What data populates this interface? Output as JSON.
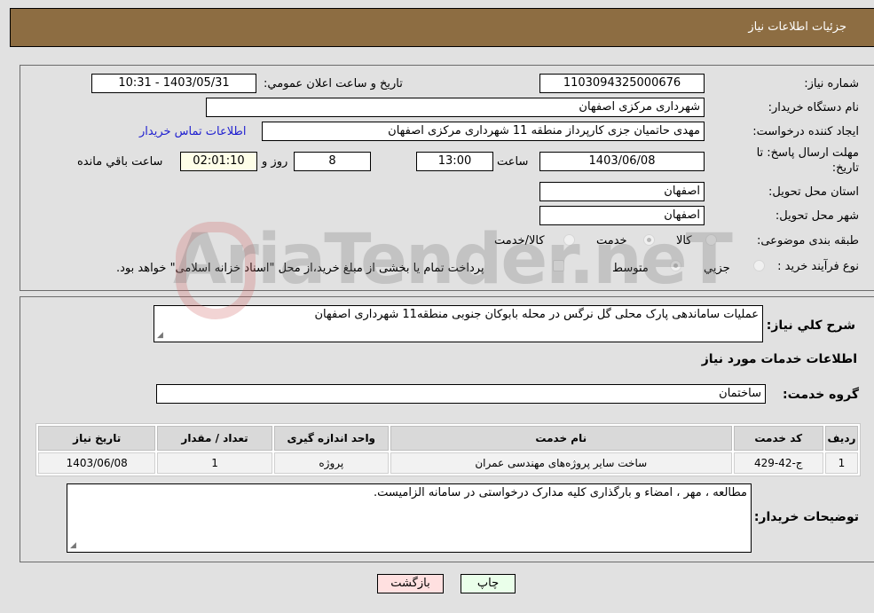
{
  "header": {
    "title": "جزئیات اطلاعات نیاز"
  },
  "form": {
    "need_number": {
      "label": "شماره نیاز:",
      "value": "1103094325000676"
    },
    "announce_datetime": {
      "label": "تاریخ و ساعت اعلان عمومي:",
      "value": "1403/05/31 - 10:31"
    },
    "buyer_org": {
      "label": "نام دستگاه خریدار:",
      "value": "شهرداری مرکزی اصفهان"
    },
    "requester": {
      "label": "ایجاد کننده درخواست:",
      "value": "مهدی حاتمیان جزی کارپرداز منطقه 11 شهرداری مرکزی اصفهان"
    },
    "buyer_contact_link": "اطلاعات تماس خریدار",
    "deadline": {
      "label_line1": "مهلت ارسال پاسخ: تا",
      "label_line2": "تاریخ:",
      "date": "1403/06/08",
      "time_label": "ساعت",
      "time": "13:00",
      "days": "8",
      "days_label": "روز و",
      "remaining": "02:01:10",
      "remaining_label": "ساعت باقي مانده"
    },
    "province": {
      "label": "استان محل تحویل:",
      "value": "اصفهان"
    },
    "city": {
      "label": "شهر محل تحویل:",
      "value": "اصفهان"
    },
    "category": {
      "label": "طبقه بندی موضوعی:",
      "options": [
        "کالا",
        "خدمت",
        "کالا/خدمت"
      ],
      "selected": "خدمت"
    },
    "process_type": {
      "label": "نوع فرآیند خرید :",
      "options": [
        "جزيي",
        "متوسط"
      ],
      "selected": "متوسط",
      "treasury_note": "پرداخت تمام یا بخشی از مبلغ خرید،از محل \"اسناد خزانه اسلامی\" خواهد بود."
    }
  },
  "details": {
    "general_desc_label": "شرح کلي نیاز:",
    "general_desc": "عملیات ساماندهی پارک محلی گل نرگس در محله بابوکان جنوبی منطقه11 شهرداری اصفهان",
    "services_heading": "اطلاعات خدمات مورد نیاز",
    "service_group_label": "گروه خدمت:",
    "service_group": "ساختمان",
    "table": {
      "headers": [
        "ردیف",
        "کد خدمت",
        "نام خدمت",
        "واحد اندازه گیری",
        "تعداد / مقدار",
        "تاریخ نیاز"
      ],
      "rows": [
        [
          "1",
          "ج-42-429",
          "ساخت سایر پروژه‌های مهندسی عمران",
          "پروژه",
          "1",
          "1403/06/08"
        ]
      ]
    },
    "buyer_notes_label": "توضیحات خریدار:",
    "buyer_notes": "مطالعه ، مهر ، امضاء و بارگذاری کلیه مدارک درخواستی در سامانه الزامیست."
  },
  "buttons": {
    "print": "چاپ",
    "back": "بازگشت"
  },
  "watermark": "AriaTender.neT"
}
